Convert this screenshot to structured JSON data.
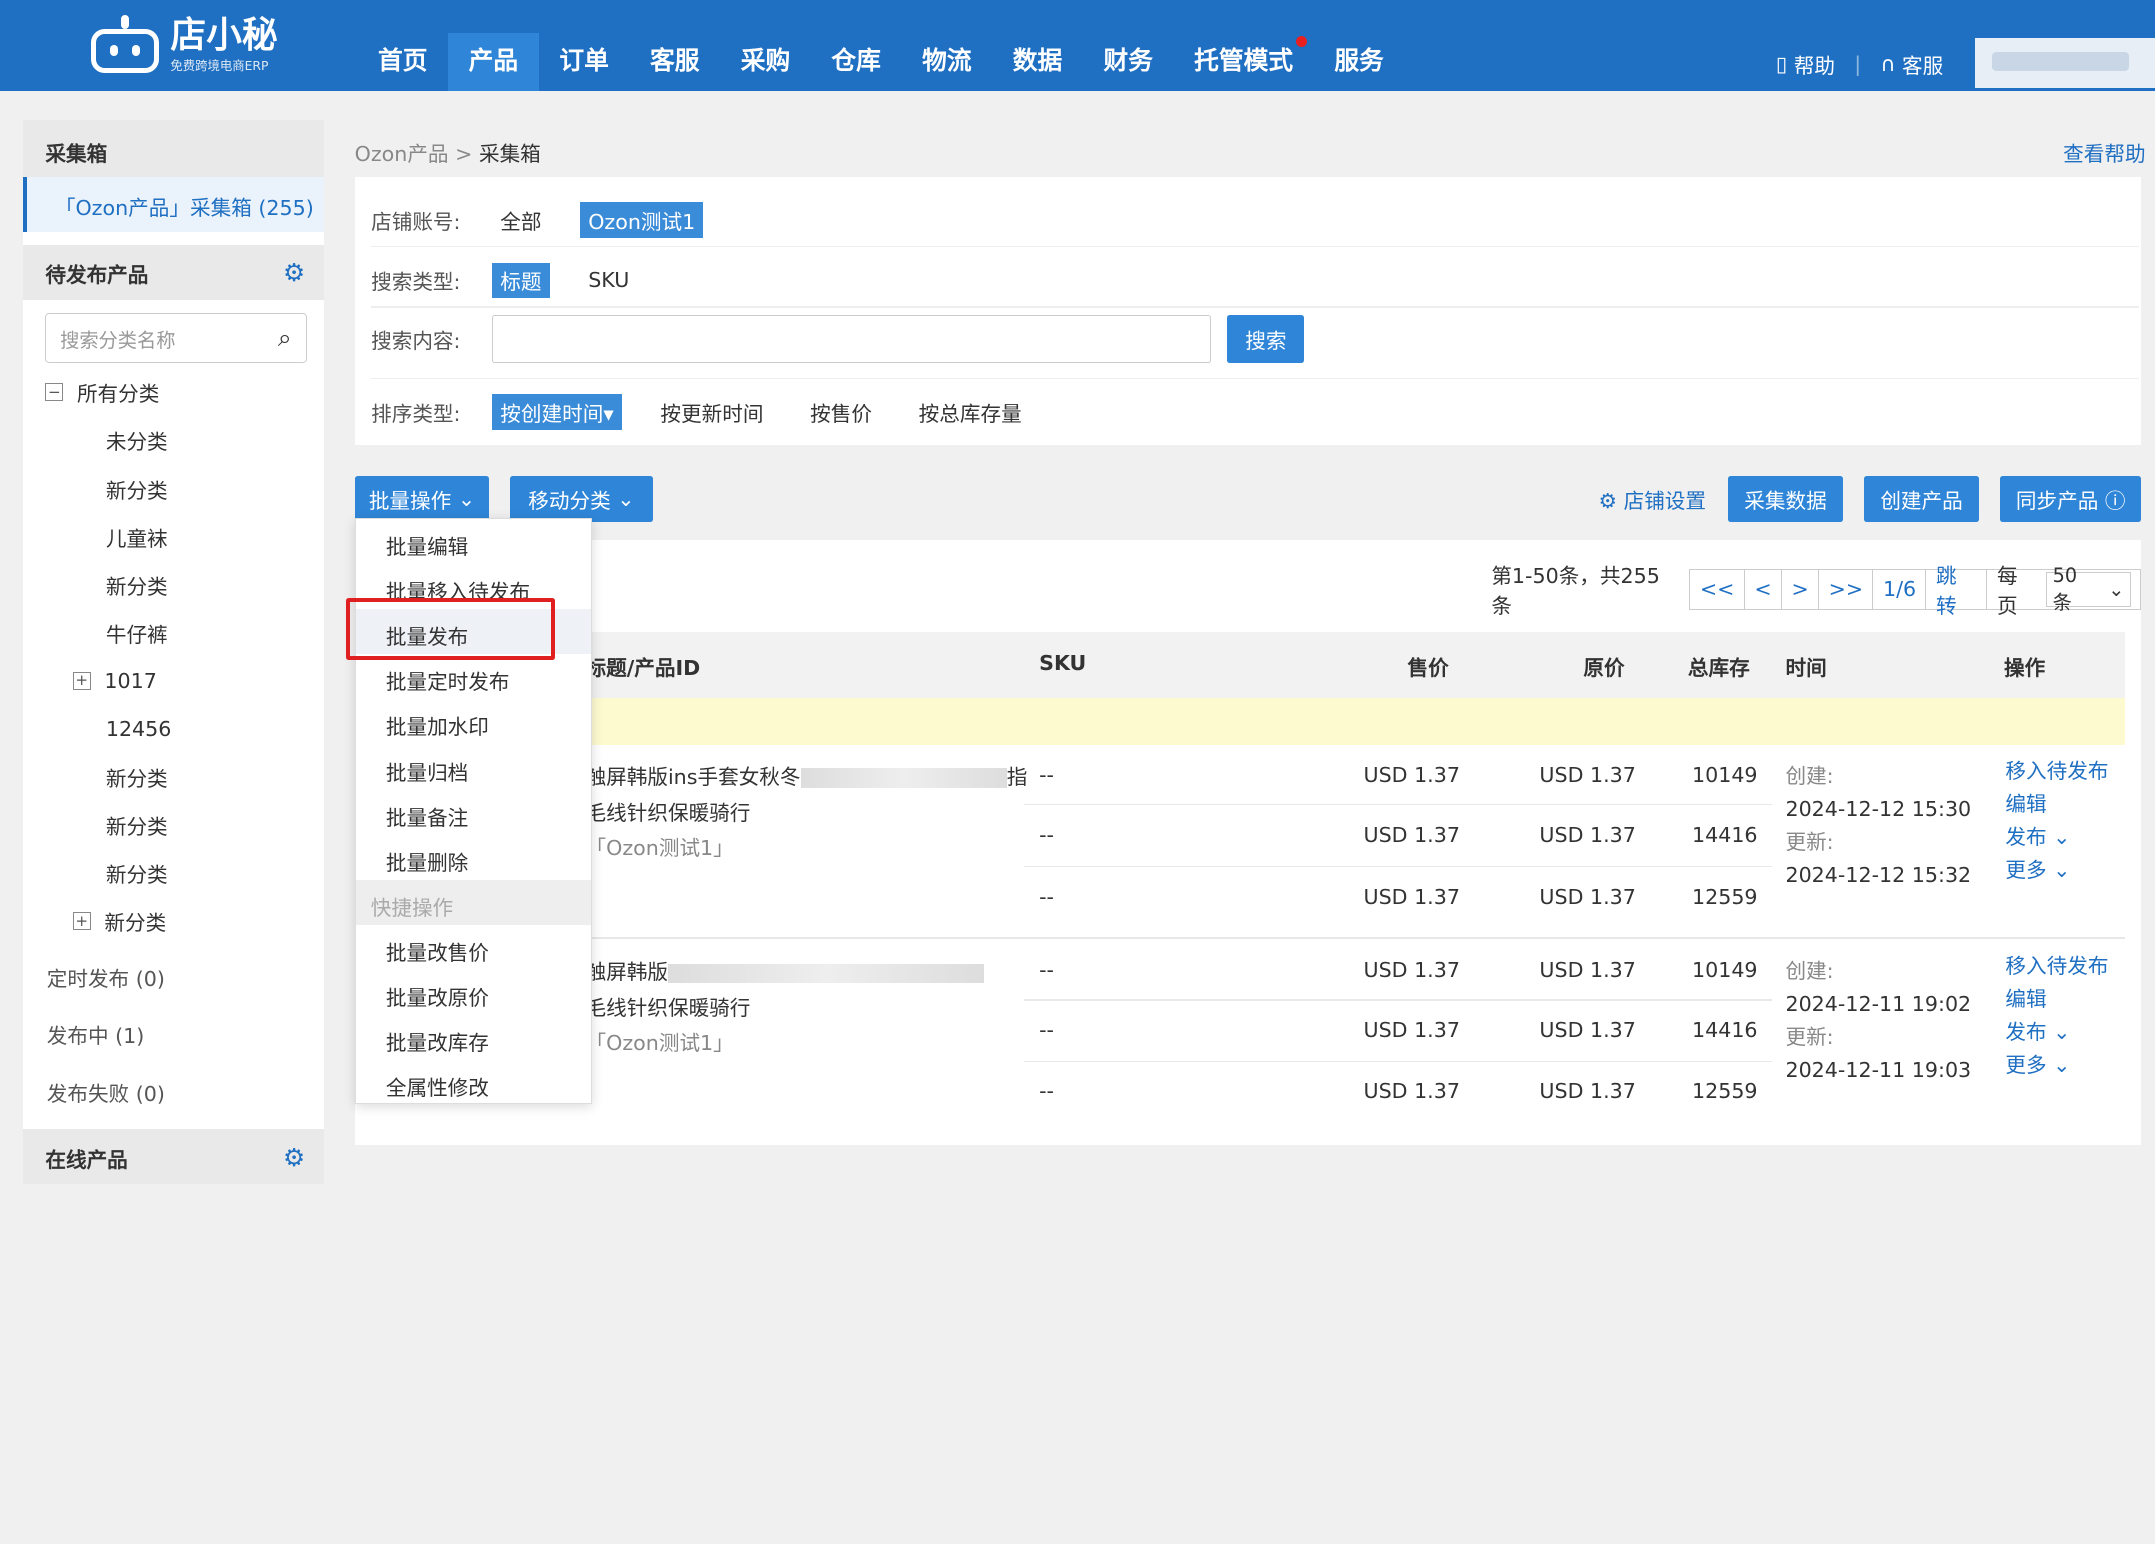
{
  "app": {
    "logo_name": "店小秘",
    "logo_sub": "免费跨境电商ERP"
  },
  "nav": [
    "首页",
    "产品",
    "订单",
    "客服",
    "采购",
    "仓库",
    "物流",
    "数据",
    "财务",
    "托管模式",
    "服务"
  ],
  "top_right": {
    "help": "帮助",
    "service": "客服"
  },
  "sidebar": {
    "head": "采集箱",
    "ozon_box": "「Ozon产品」采集箱 (255)",
    "pending": "待发布产品",
    "search_placeholder": "搜索分类名称",
    "tree": [
      {
        "label": "所有分类",
        "level": 0,
        "toggle": "−"
      },
      {
        "label": "未分类",
        "level": 1
      },
      {
        "label": "新分类",
        "level": 1
      },
      {
        "label": "儿童袜",
        "level": 1
      },
      {
        "label": "新分类",
        "level": 1
      },
      {
        "label": "牛仔裤",
        "level": 1
      },
      {
        "label": "1017",
        "level": 2,
        "toggle": "+"
      },
      {
        "label": "12456",
        "level": 1
      },
      {
        "label": "新分类",
        "level": 1
      },
      {
        "label": "新分类",
        "level": 1
      },
      {
        "label": "新分类",
        "level": 1
      },
      {
        "label": "新分类",
        "level": 2,
        "toggle": "+"
      }
    ],
    "scheduled": "定时发布 (0)",
    "publishing": "发布中 (1)",
    "failed": "发布失败 (0)",
    "online": "在线产品"
  },
  "breadcrumb": {
    "parent": "Ozon产品",
    "sep": ">",
    "current": "采集箱"
  },
  "view_help": "查看帮助",
  "filter": {
    "shop_label": "店铺账号:",
    "shop_all": "全部",
    "shop_sel": "Ozon测试1",
    "type_label": "搜索类型:",
    "type_title": "标题",
    "type_sku": "SKU",
    "content_label": "搜索内容:",
    "search_btn": "搜索",
    "sort_label": "排序类型:",
    "sort_created": "按创建时间",
    "sort_updated": "按更新时间",
    "sort_price": "按售价",
    "sort_stock": "按总库存量"
  },
  "toolbar": {
    "batch": "批量操作",
    "move": "移动分类",
    "shop_settings": "店铺设置",
    "collect": "采集数据",
    "create": "创建产品",
    "sync": "同步产品"
  },
  "pager": {
    "info": "第1-50条，共255条",
    "first": "<<",
    "prev": "<",
    "next": ">",
    "last": ">>",
    "page": "1/6",
    "jump": "跳转",
    "per_page_label": "每页",
    "per_page": "50条"
  },
  "table": {
    "headers": {
      "title": "标题/产品ID",
      "sku": "SKU",
      "price": "售价",
      "orig": "原价",
      "stock": "总库存",
      "time": "时间",
      "ops": "操作"
    },
    "products": [
      {
        "title1a": "触屏韩版ins手套女秋冬",
        "title1b": "指",
        "title2": "毛线针织保暖骑行",
        "shop": "「Ozon测试1」",
        "variants": [
          {
            "sku": "--",
            "price": "USD 1.37",
            "orig": "USD 1.37",
            "stock": "10149"
          },
          {
            "sku": "--",
            "price": "USD 1.37",
            "orig": "USD 1.37",
            "stock": "14416"
          },
          {
            "sku": "--",
            "price": "USD 1.37",
            "orig": "USD 1.37",
            "stock": "12559"
          }
        ],
        "created_label": "创建:",
        "created": "2024-12-12 15:30",
        "updated_label": "更新:",
        "updated": "2024-12-12 15:32",
        "ops": [
          "移入待发布",
          "编辑",
          "发布",
          "更多"
        ]
      },
      {
        "title1a": "触屏韩版",
        "title1b": "",
        "title2": "毛线针织保暖骑行",
        "shop": "「Ozon测试1」",
        "variants": [
          {
            "sku": "--",
            "price": "USD 1.37",
            "orig": "USD 1.37",
            "stock": "10149"
          },
          {
            "sku": "--",
            "price": "USD 1.37",
            "orig": "USD 1.37",
            "stock": "14416"
          },
          {
            "sku": "--",
            "price": "USD 1.37",
            "orig": "USD 1.37",
            "stock": "12559"
          }
        ],
        "created_label": "创建:",
        "created": "2024-12-11 19:02",
        "updated_label": "更新:",
        "updated": "2024-12-11 19:03",
        "ops": [
          "移入待发布",
          "编辑",
          "发布",
          "更多"
        ]
      }
    ]
  },
  "dropdown": {
    "items": [
      "批量编辑",
      "批量移入待发布",
      "批量发布",
      "批量定时发布",
      "批量加水印",
      "批量归档",
      "批量备注",
      "批量删除"
    ],
    "quick_head": "快捷操作",
    "quick_items": [
      "批量改售价",
      "批量改原价",
      "批量改库存",
      "全属性修改"
    ],
    "highlighted": "批量发布"
  },
  "colors": {
    "brand": "#1f6fc2",
    "button": "#2f86d8",
    "highlight_box": "#e02020"
  }
}
